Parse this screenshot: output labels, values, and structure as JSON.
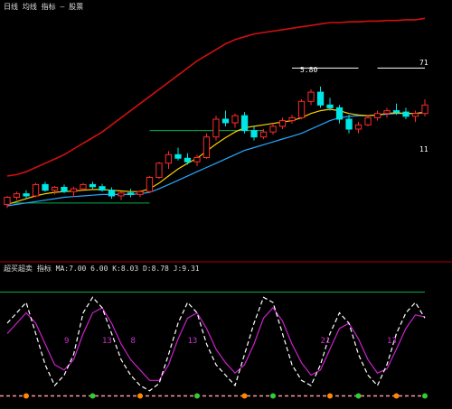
{
  "top_panel": {
    "header_text": "日线 均线 指标 — 股票",
    "header_color": "#dddddd",
    "price_labels": {
      "pivot_high": "5.80",
      "upper_right": "71",
      "lower_right": "11"
    }
  },
  "bottom_panel": {
    "header_text": "超买超卖 指标 MA:7.00 6.00 K:8.03 D:8.78 J:9.31",
    "cycle_labels": [
      "9",
      "13",
      "8",
      "13",
      "21",
      "13"
    ],
    "cycle_labels_color": "#cc33cc",
    "marker_color": "#ff8800"
  },
  "colors": {
    "background": "#000000",
    "up_candle": "#ff2b2b",
    "down_candle": "#00e5e5",
    "upper_band": "#d01010",
    "ma_fast": "#ffd000",
    "ma_slow": "#29a8ff",
    "support_line": "#00b050",
    "k_line": "#ffffff",
    "d_line": "#cc22cc",
    "zero_line": "#ff9999"
  },
  "chart_data": [
    {
      "type": "candlestick",
      "panel": "price",
      "ylim": [
        4.0,
        7.0
      ],
      "candles": [
        {
          "o": 4.3,
          "h": 4.42,
          "l": 4.25,
          "c": 4.4
        },
        {
          "o": 4.4,
          "h": 4.48,
          "l": 4.36,
          "c": 4.45
        },
        {
          "o": 4.45,
          "h": 4.5,
          "l": 4.38,
          "c": 4.42
        },
        {
          "o": 4.42,
          "h": 4.6,
          "l": 4.4,
          "c": 4.58
        },
        {
          "o": 4.58,
          "h": 4.62,
          "l": 4.48,
          "c": 4.5
        },
        {
          "o": 4.5,
          "h": 4.56,
          "l": 4.44,
          "c": 4.54
        },
        {
          "o": 4.54,
          "h": 4.58,
          "l": 4.46,
          "c": 4.48
        },
        {
          "o": 4.48,
          "h": 4.55,
          "l": 4.4,
          "c": 4.52
        },
        {
          "o": 4.52,
          "h": 4.6,
          "l": 4.5,
          "c": 4.58
        },
        {
          "o": 4.58,
          "h": 4.62,
          "l": 4.52,
          "c": 4.55
        },
        {
          "o": 4.55,
          "h": 4.59,
          "l": 4.48,
          "c": 4.5
        },
        {
          "o": 4.5,
          "h": 4.54,
          "l": 4.38,
          "c": 4.42
        },
        {
          "o": 4.42,
          "h": 4.48,
          "l": 4.36,
          "c": 4.46
        },
        {
          "o": 4.46,
          "h": 4.52,
          "l": 4.4,
          "c": 4.44
        },
        {
          "o": 4.44,
          "h": 4.5,
          "l": 4.4,
          "c": 4.48
        },
        {
          "o": 4.48,
          "h": 4.7,
          "l": 4.46,
          "c": 4.68
        },
        {
          "o": 4.68,
          "h": 4.9,
          "l": 4.66,
          "c": 4.88
        },
        {
          "o": 4.88,
          "h": 5.05,
          "l": 4.8,
          "c": 5.0
        },
        {
          "o": 5.0,
          "h": 5.1,
          "l": 4.92,
          "c": 4.95
        },
        {
          "o": 4.95,
          "h": 5.02,
          "l": 4.86,
          "c": 4.9
        },
        {
          "o": 4.9,
          "h": 5.0,
          "l": 4.84,
          "c": 4.96
        },
        {
          "o": 4.96,
          "h": 5.3,
          "l": 4.94,
          "c": 5.25
        },
        {
          "o": 5.25,
          "h": 5.55,
          "l": 5.2,
          "c": 5.5
        },
        {
          "o": 5.5,
          "h": 5.62,
          "l": 5.4,
          "c": 5.45
        },
        {
          "o": 5.45,
          "h": 5.58,
          "l": 5.38,
          "c": 5.55
        },
        {
          "o": 5.55,
          "h": 5.6,
          "l": 5.3,
          "c": 5.34
        },
        {
          "o": 5.34,
          "h": 5.4,
          "l": 5.2,
          "c": 5.25
        },
        {
          "o": 5.25,
          "h": 5.36,
          "l": 5.22,
          "c": 5.32
        },
        {
          "o": 5.32,
          "h": 5.44,
          "l": 5.28,
          "c": 5.4
        },
        {
          "o": 5.4,
          "h": 5.52,
          "l": 5.36,
          "c": 5.48
        },
        {
          "o": 5.48,
          "h": 5.56,
          "l": 5.44,
          "c": 5.52
        },
        {
          "o": 5.52,
          "h": 5.78,
          "l": 5.5,
          "c": 5.75
        },
        {
          "o": 5.75,
          "h": 5.92,
          "l": 5.7,
          "c": 5.88
        },
        {
          "o": 5.88,
          "h": 5.96,
          "l": 5.66,
          "c": 5.7
        },
        {
          "o": 5.7,
          "h": 5.8,
          "l": 5.62,
          "c": 5.66
        },
        {
          "o": 5.66,
          "h": 5.7,
          "l": 5.44,
          "c": 5.5
        },
        {
          "o": 5.5,
          "h": 5.56,
          "l": 5.3,
          "c": 5.36
        },
        {
          "o": 5.36,
          "h": 5.46,
          "l": 5.3,
          "c": 5.42
        },
        {
          "o": 5.42,
          "h": 5.56,
          "l": 5.4,
          "c": 5.52
        },
        {
          "o": 5.52,
          "h": 5.62,
          "l": 5.48,
          "c": 5.58
        },
        {
          "o": 5.58,
          "h": 5.66,
          "l": 5.52,
          "c": 5.62
        },
        {
          "o": 5.62,
          "h": 5.72,
          "l": 5.56,
          "c": 5.6
        },
        {
          "o": 5.6,
          "h": 5.66,
          "l": 5.5,
          "c": 5.54
        },
        {
          "o": 5.54,
          "h": 5.62,
          "l": 5.46,
          "c": 5.58
        },
        {
          "o": 5.58,
          "h": 5.78,
          "l": 5.54,
          "c": 5.7
        }
      ],
      "upper_band": [
        4.7,
        4.72,
        4.76,
        4.82,
        4.88,
        4.94,
        5.0,
        5.08,
        5.16,
        5.24,
        5.32,
        5.42,
        5.52,
        5.62,
        5.72,
        5.82,
        5.92,
        6.02,
        6.12,
        6.22,
        6.32,
        6.4,
        6.48,
        6.56,
        6.62,
        6.66,
        6.7,
        6.72,
        6.74,
        6.76,
        6.78,
        6.8,
        6.82,
        6.84,
        6.86,
        6.86,
        6.87,
        6.87,
        6.88,
        6.88,
        6.89,
        6.89,
        6.9,
        6.9,
        6.92
      ],
      "ma_fast": [
        4.3,
        4.34,
        4.38,
        4.42,
        4.45,
        4.47,
        4.48,
        4.49,
        4.5,
        4.51,
        4.51,
        4.5,
        4.49,
        4.48,
        4.48,
        4.52,
        4.6,
        4.7,
        4.8,
        4.88,
        4.95,
        5.05,
        5.15,
        5.24,
        5.32,
        5.38,
        5.4,
        5.42,
        5.44,
        5.46,
        5.48,
        5.52,
        5.58,
        5.62,
        5.64,
        5.62,
        5.58,
        5.56,
        5.55,
        5.56,
        5.58,
        5.59,
        5.58,
        5.58,
        5.6
      ],
      "ma_slow": [
        4.28,
        4.3,
        4.32,
        4.34,
        4.36,
        4.38,
        4.4,
        4.41,
        4.42,
        4.43,
        4.44,
        4.44,
        4.44,
        4.44,
        4.45,
        4.47,
        4.52,
        4.58,
        4.64,
        4.7,
        4.76,
        4.82,
        4.88,
        4.94,
        5.0,
        5.06,
        5.1,
        5.14,
        5.18,
        5.22,
        5.26,
        5.3,
        5.36,
        5.42,
        5.48,
        5.52,
        5.54,
        5.55,
        5.55,
        5.56,
        5.57,
        5.58,
        5.58,
        5.58,
        5.59
      ]
    },
    {
      "type": "line",
      "panel": "oscillator",
      "ylim": [
        -10,
        110
      ],
      "series": [
        {
          "name": "K",
          "values": [
            70,
            80,
            90,
            60,
            30,
            10,
            20,
            40,
            80,
            95,
            85,
            60,
            35,
            20,
            10,
            5,
            12,
            40,
            70,
            90,
            80,
            50,
            30,
            20,
            10,
            40,
            70,
            95,
            90,
            60,
            30,
            15,
            10,
            30,
            60,
            80,
            70,
            40,
            20,
            10,
            30,
            60,
            80,
            90,
            75
          ]
        },
        {
          "name": "D",
          "values": [
            60,
            70,
            80,
            70,
            50,
            30,
            25,
            35,
            60,
            80,
            85,
            70,
            50,
            35,
            25,
            15,
            15,
            30,
            55,
            75,
            80,
            65,
            45,
            32,
            22,
            30,
            50,
            75,
            85,
            72,
            50,
            32,
            20,
            25,
            45,
            65,
            70,
            55,
            35,
            22,
            26,
            45,
            65,
            78,
            76
          ]
        }
      ]
    }
  ]
}
